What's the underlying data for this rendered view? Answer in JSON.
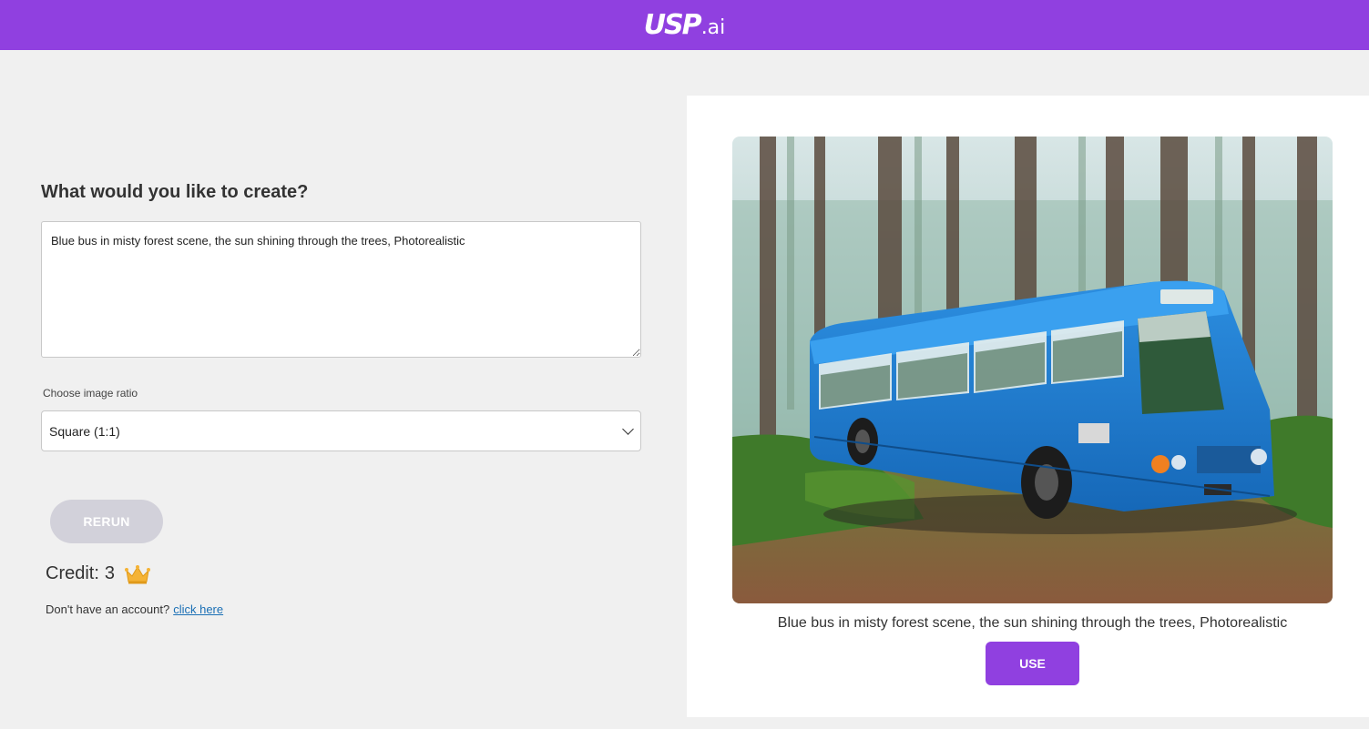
{
  "header": {
    "logo_main": "USP",
    "logo_suffix": ".ai",
    "background_color": "#9040e0"
  },
  "form": {
    "heading": "What would you like to create?",
    "prompt_value": "Blue bus in misty forest scene, the sun shining through the trees, Photorealistic",
    "ratio_label": "Choose image ratio",
    "ratio_selected": "Square (1:1)",
    "rerun_label": "RERUN",
    "credit_label": "Credit:",
    "credit_value": "3",
    "credit_icon": "crown-icon",
    "account_text": "Don't have an account?",
    "account_link": "click here"
  },
  "result": {
    "image_icon": "generated-image",
    "caption": "Blue bus in misty forest scene, the sun shining through the trees, Photorealistic",
    "use_label": "USE"
  },
  "colors": {
    "accent": "#9040e0",
    "rerun_disabled": "#d2d1da",
    "link": "#1a6fb5",
    "page_bg": "#f0f0f0"
  }
}
